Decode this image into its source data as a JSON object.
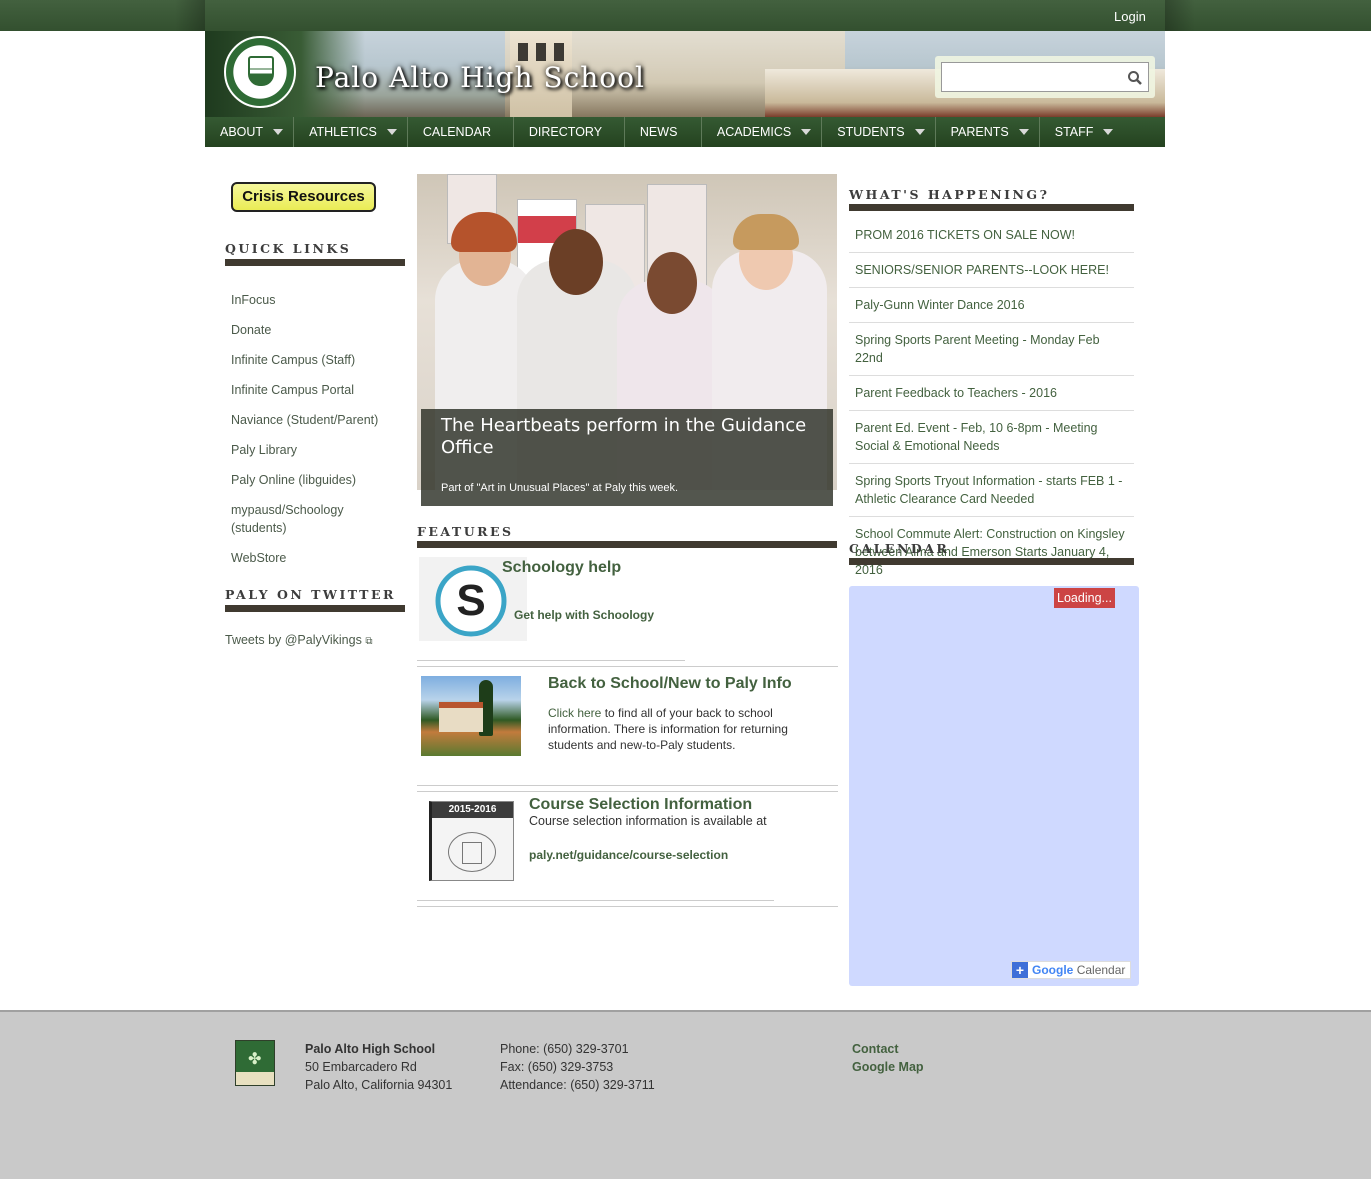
{
  "topbar": {
    "login": "Login"
  },
  "header": {
    "title": "Palo Alto High School",
    "search_placeholder": ""
  },
  "nav": [
    {
      "label": "ABOUT",
      "dropdown": true
    },
    {
      "label": "ATHLETICS",
      "dropdown": true
    },
    {
      "label": "CALENDAR",
      "dropdown": false
    },
    {
      "label": "DIRECTORY",
      "dropdown": false
    },
    {
      "label": "NEWS",
      "dropdown": false
    },
    {
      "label": "ACADEMICS",
      "dropdown": true
    },
    {
      "label": "STUDENTS",
      "dropdown": true
    },
    {
      "label": "PARENTS",
      "dropdown": true
    },
    {
      "label": "STAFF",
      "dropdown": true
    }
  ],
  "sidebar": {
    "crisis_label": "Crisis Resources",
    "quick_links_title": "QUICK LINKS",
    "quick_links": [
      "InFocus",
      "Donate",
      "Infinite Campus (Staff)",
      "Infinite Campus Portal",
      "Naviance (Student/Parent)",
      "Paly Library",
      "Paly Online (libguides)",
      "mypausd/Schoology (students)",
      "WebStore"
    ],
    "twitter_title": "PALY ON TWITTER",
    "twitter_link": "Tweets by @PalyVikings"
  },
  "slideshow": {
    "title": "The Heartbeats perform in the Guidance Office",
    "subtitle": "Part of \"Art in Unusual Places\" at Paly this week."
  },
  "features": {
    "title": "FEATURES",
    "items": [
      {
        "heading": "Schoology help",
        "link": "Get help with Schoology"
      },
      {
        "heading": "Back to School/New to Paly Info",
        "link": "Click here",
        "text": " to find all of your back to school information. There is information for returning students and new-to-Paly students."
      },
      {
        "heading": "Course Selection Information",
        "text": "Course selection information is available at",
        "link": "paly.net/guidance/course-selection",
        "thumb_label": "2015-2016"
      }
    ]
  },
  "whats_happening": {
    "title": "WHAT'S HAPPENING?",
    "items": [
      "PROM 2016 TICKETS ON SALE NOW!",
      "SENIORS/SENIOR PARENTS--LOOK HERE!",
      "Paly-Gunn Winter Dance 2016",
      "Spring Sports Parent Meeting - Monday Feb 22nd",
      "Parent Feedback to Teachers - 2016",
      "Parent Ed. Event - Feb, 10 6-8pm - Meeting Social & Emotional Needs",
      "Spring Sports Tryout Information - starts FEB 1 - Athletic Clearance Card Needed",
      "School Commute Alert: Construction on Kingsley between Alma and Emerson Starts January 4, 2016"
    ]
  },
  "calendar": {
    "title": "CALENDAR",
    "loading": "Loading...",
    "badge_google": "Google",
    "badge_calendar": "Calendar"
  },
  "footer": {
    "school_name": "Palo Alto High School",
    "address1": "50 Embarcadero Rd",
    "address2": "Palo Alto, California 94301",
    "phone": "Phone: (650) 329-3701",
    "fax": "Fax: (650) 329-3753",
    "attendance": "Attendance: (650) 329-3711",
    "contact": "Contact",
    "map": "Google Map"
  },
  "colors": {
    "brand_green": "#43613f",
    "nav_green": "#2c4a28",
    "bar_dark": "#403a30"
  }
}
